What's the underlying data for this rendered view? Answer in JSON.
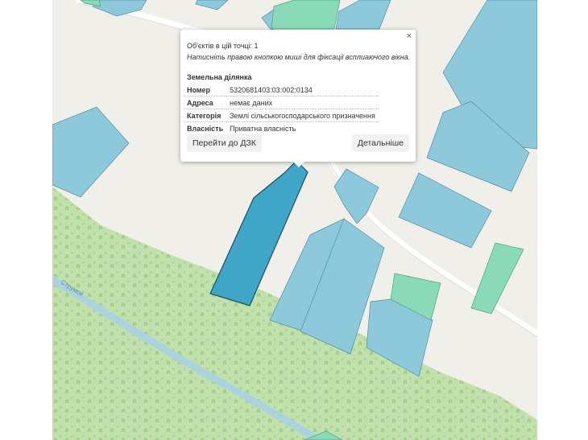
{
  "map": {
    "colors": {
      "background": "#f1efe9",
      "parcel_fill": "#8ec9db",
      "parcel_stroke": "#4f8ea6",
      "selected_fill": "#3fa6c7",
      "selected_stroke": "#1c4f62",
      "green_parcel": "#8ad9b8",
      "meadow": "#c2e0ad",
      "road": "#ffffff",
      "stream": "#aad3df"
    },
    "stream_label": "Струмок"
  },
  "popup": {
    "close_symbol": "×",
    "objects_count": "Об'єктів в цій точці: 1",
    "hint": "Натисніть правою кнопкою миші для фіксації всплиаючого вікна.",
    "section_title": "Земельна ділянка",
    "rows": [
      {
        "key": "Номер",
        "value": "5320681403:03:002:0134"
      },
      {
        "key": "Адреса",
        "value": "немає даних"
      },
      {
        "key": "Категорія",
        "value": "Землі сільськогосподарського призначення"
      },
      {
        "key": "Власність",
        "value": "Приватна власність"
      }
    ],
    "button_dzk": "Перейти до ДЗК",
    "button_details": "Детальніше"
  }
}
